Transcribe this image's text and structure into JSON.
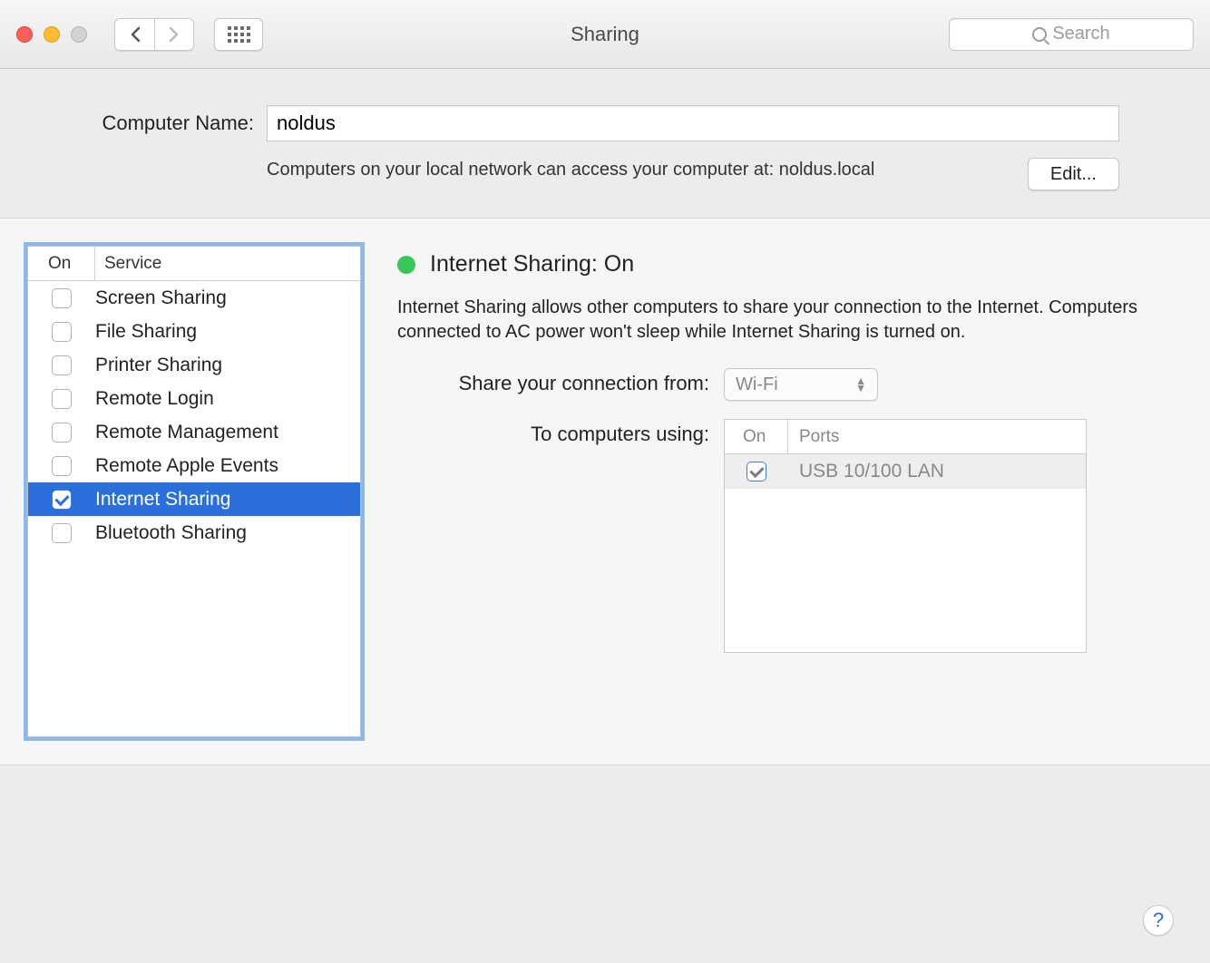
{
  "window_title": "Sharing",
  "search_placeholder": "Search",
  "computer_name": {
    "label": "Computer Name:",
    "value": "noldus",
    "hint": "Computers on your local network can access your computer at: noldus.local",
    "edit_button": "Edit..."
  },
  "service_table": {
    "headers": {
      "on": "On",
      "service": "Service"
    },
    "rows": [
      {
        "on": false,
        "label": "Screen Sharing",
        "selected": false
      },
      {
        "on": false,
        "label": "File Sharing",
        "selected": false
      },
      {
        "on": false,
        "label": "Printer Sharing",
        "selected": false
      },
      {
        "on": false,
        "label": "Remote Login",
        "selected": false
      },
      {
        "on": false,
        "label": "Remote Management",
        "selected": false
      },
      {
        "on": false,
        "label": "Remote Apple Events",
        "selected": false
      },
      {
        "on": true,
        "label": "Internet Sharing",
        "selected": true
      },
      {
        "on": false,
        "label": "Bluetooth Sharing",
        "selected": false
      }
    ]
  },
  "detail": {
    "status_title": "Internet Sharing: On",
    "description": "Internet Sharing allows other computers to share your connection to the Internet. Computers connected to AC power won't sleep while Internet Sharing is turned on.",
    "share_from_label": "Share your connection from:",
    "share_from_value": "Wi-Fi",
    "to_computers_label": "To computers using:",
    "ports_headers": {
      "on": "On",
      "ports": "Ports"
    },
    "ports": [
      {
        "on": true,
        "label": "USB 10/100 LAN"
      }
    ]
  },
  "help_label": "?"
}
